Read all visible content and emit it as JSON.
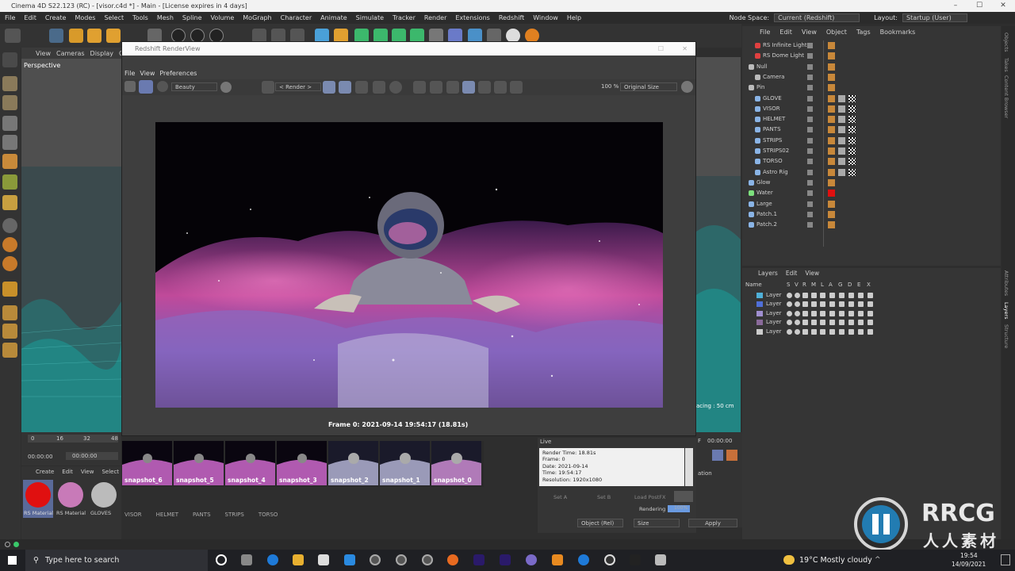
{
  "app": {
    "title": "Cinema 4D S22.123 (RC) - [visor.c4d *] - Main - [License expires in 4 days]",
    "menu": [
      "File",
      "Edit",
      "Create",
      "Modes",
      "Select",
      "Tools",
      "Mesh",
      "Spline",
      "Volume",
      "MoGraph",
      "Character",
      "Animate",
      "Simulate",
      "Tracker",
      "Render",
      "Extensions",
      "Redshift",
      "Window",
      "Help"
    ],
    "node_space_label": "Node Space:",
    "node_space_value": "Current (Redshift)",
    "layout_label": "Layout:",
    "layout_value": "Startup (User)"
  },
  "viewport": {
    "menu": [
      "View",
      "Cameras",
      "Display",
      "Op"
    ],
    "label": "Perspective",
    "spacing": "acing : 50 cm"
  },
  "renderview": {
    "title": "Redshift RenderView",
    "menu": [
      "File",
      "View",
      "Preferences"
    ],
    "aov": "Beauty",
    "render_dropdown": "< Render >",
    "zoom": "100 %",
    "size_dropdown": "Original Size",
    "frame_caption": "Frame  0:  2021-09-14  19:54:17  (18.81s)"
  },
  "snapshots": [
    "snapshot_6",
    "snapshot_5",
    "snapshot_4",
    "snapshot_3",
    "snapshot_2",
    "snapshot_1",
    "snapshot_0"
  ],
  "live": {
    "label": "Live",
    "lines": [
      "Render Time: 18.81s",
      "Frame: 0",
      "Date: 2021-09-14",
      "Time: 19:54:17",
      "Resolution: 1920x1080"
    ],
    "set_a": "Set A",
    "set_b": "Set B",
    "load_postfx": "Load PostFX",
    "rendering": "Rendering",
    "rendering_pct": "100%",
    "rendering_progress": 1.0
  },
  "timeline": {
    "ticks": [
      "0",
      "16",
      "32",
      "48"
    ],
    "time1": "00:00:00",
    "time2": "00:00:00",
    "time3": "00:00:00",
    "f_label": "F",
    "ation": "ation"
  },
  "material_panel": {
    "menu": [
      "Create",
      "Edit",
      "View",
      "Select"
    ],
    "materials": [
      "RS Material",
      "RS Material",
      "GLOVES"
    ],
    "more": [
      "VISOR",
      "HELMET",
      "PANTS",
      "STRIPS",
      "TORSO"
    ]
  },
  "bottom_controls": {
    "object_rel": "Object (Rel)",
    "size": "Size",
    "apply": "Apply"
  },
  "object_manager": {
    "menu": [
      "File",
      "Edit",
      "View",
      "Object",
      "Tags",
      "Bookmarks"
    ],
    "objects": [
      {
        "name": "RS Infinite Light",
        "icon": "light-icon",
        "color": "#e04040"
      },
      {
        "name": "RS Dome Light",
        "icon": "light-icon",
        "color": "#e04040"
      },
      {
        "name": "Null",
        "icon": "null-icon",
        "color": "#bbbbbb"
      },
      {
        "name": "Camera",
        "icon": "camera-icon",
        "color": "#bbbbbb"
      },
      {
        "name": "Pin",
        "icon": "group-icon",
        "color": "#bbbbbb"
      },
      {
        "name": "GLOVE",
        "icon": "mesh-icon",
        "color": "#8ab4e6"
      },
      {
        "name": "VISOR",
        "icon": "mesh-icon",
        "color": "#8ab4e6"
      },
      {
        "name": "HELMET",
        "icon": "mesh-icon",
        "color": "#8ab4e6"
      },
      {
        "name": "PANTS",
        "icon": "mesh-icon",
        "color": "#8ab4e6"
      },
      {
        "name": "STRIPS",
        "icon": "mesh-icon",
        "color": "#8ab4e6"
      },
      {
        "name": "STRIPS02",
        "icon": "mesh-icon",
        "color": "#8ab4e6"
      },
      {
        "name": "TORSO",
        "icon": "mesh-icon",
        "color": "#8ab4e6"
      },
      {
        "name": "Astro Rig",
        "icon": "rig-icon",
        "color": "#8ab4e6"
      },
      {
        "name": "Glow",
        "icon": "plane-icon",
        "color": "#8ab4e6"
      },
      {
        "name": "Water",
        "icon": "plane-icon",
        "color": "#7de07d"
      },
      {
        "name": "Large",
        "icon": "plane-icon",
        "color": "#8ab4e6"
      },
      {
        "name": "Patch.1",
        "icon": "mesh-icon",
        "color": "#8ab4e6"
      },
      {
        "name": "Patch.2",
        "icon": "mesh-icon",
        "color": "#8ab4e6"
      }
    ]
  },
  "layers": {
    "menu": [
      "Layers",
      "Edit",
      "View"
    ],
    "columns": [
      "Name",
      "S",
      "V",
      "R",
      "M",
      "L",
      "A",
      "G",
      "D",
      "E",
      "X"
    ],
    "rows": [
      {
        "name": "Layer",
        "color": "#4fb0d8"
      },
      {
        "name": "Layer",
        "color": "#4f6fd8"
      },
      {
        "name": "Layer",
        "color": "#a08fd0"
      },
      {
        "name": "Layer",
        "color": "#8a6a9a"
      },
      {
        "name": "Layer",
        "color": "#cccccc"
      }
    ]
  },
  "side_tabs": [
    "Objects",
    "Takes",
    "Content Browser",
    "Attributes",
    "Layers",
    "Structure"
  ],
  "taskbar": {
    "search_placeholder": "Type here to search",
    "weather": "19°C  Mostly cloudy",
    "time": "19:54",
    "date": "14/09/2021"
  },
  "watermark": {
    "line1": "RRCG",
    "line2": "人人素材"
  }
}
